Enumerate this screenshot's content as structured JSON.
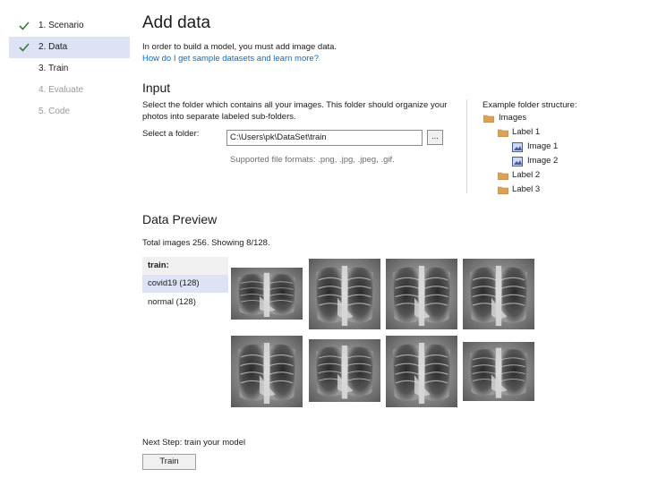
{
  "sidebar": {
    "steps": [
      {
        "label": "1. Scenario",
        "state": "done"
      },
      {
        "label": "2. Data",
        "state": "done-active"
      },
      {
        "label": "3. Train",
        "state": "enabled"
      },
      {
        "label": "4. Evaluate",
        "state": "disabled"
      },
      {
        "label": "5. Code",
        "state": "disabled"
      }
    ]
  },
  "header": {
    "title": "Add data",
    "intro": "In order to build a model, you must add image data.",
    "help_link": "How do I get sample datasets and learn more?"
  },
  "input_section": {
    "heading": "Input",
    "description_line1": "Select the folder which contains all your images. This folder should organize your",
    "description_line2": "photos into separate labeled sub-folders.",
    "folder_label": "Select a folder:",
    "folder_value": "C:\\Users\\pk\\DataSet\\train",
    "browse_label": "...",
    "formats": "Supported file formats: .png, .jpg, .jpeg, .gif."
  },
  "example": {
    "heading": "Example folder structure:",
    "items": [
      "Images",
      "Label 1",
      "Image 1",
      "Image 2",
      "Label 2",
      "Label 3"
    ]
  },
  "preview": {
    "heading": "Data Preview",
    "summary": "Total images 256. Showing 8/128.",
    "tree_header": "train:",
    "folders": [
      "covid19 (128)",
      "normal (128)"
    ],
    "thumbnail_subject": "chest x-ray"
  },
  "footer": {
    "next_step": "Next Step: train your model",
    "train_button": "Train"
  },
  "colors": {
    "accent_link": "#0a6dc2",
    "selected_bg": "#dde3f5",
    "check_green": "#2f7d32",
    "folder_orange": "#d9a15a"
  }
}
